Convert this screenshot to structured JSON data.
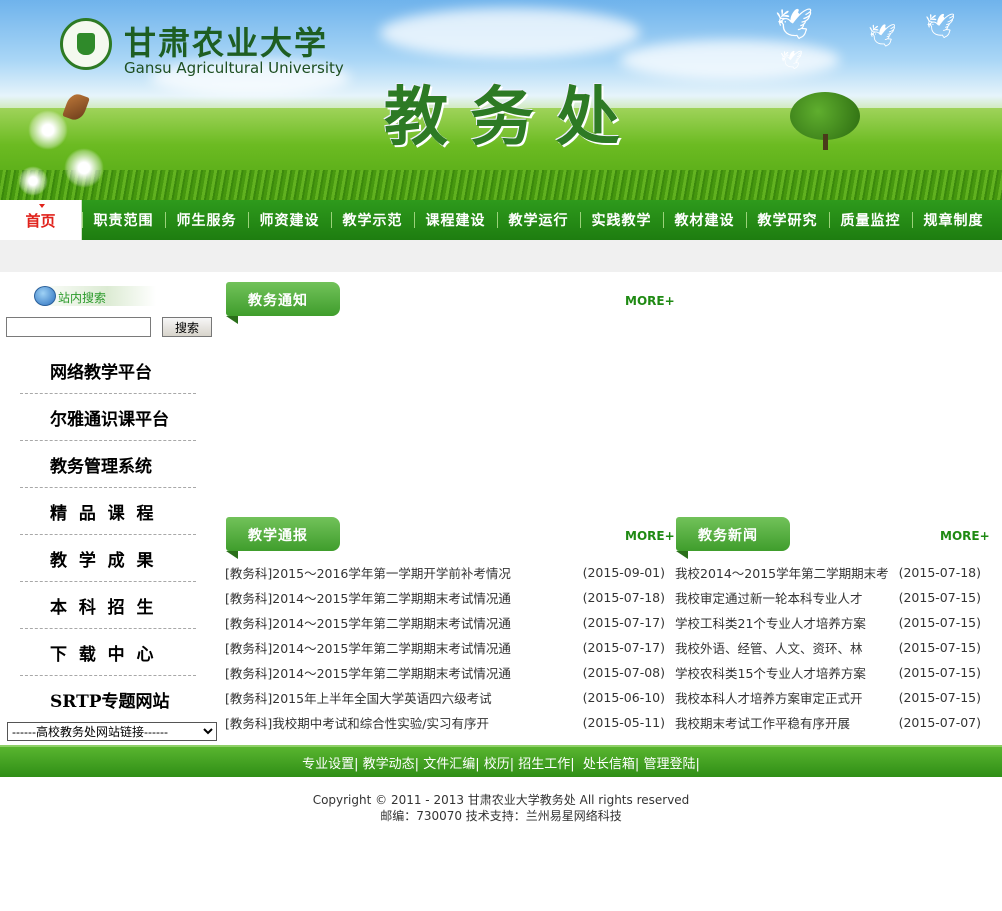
{
  "banner": {
    "university_cn": "甘肃农业大学",
    "university_en": "Gansu Agricultural University",
    "department": "教务处"
  },
  "nav": {
    "home": "首页",
    "items": [
      "职责范围",
      "师生服务",
      "师资建设",
      "教学示范",
      "课程建设",
      "教学运行",
      "实践教学",
      "教材建设",
      "教学研究",
      "质量监控",
      "规章制度"
    ]
  },
  "search": {
    "title": "站内搜索",
    "button": "搜索",
    "value": ""
  },
  "sidebar": {
    "links": [
      "网络教学平台",
      "尔雅通识课平台",
      "教务管理系统",
      "精  品  课  程",
      "教  学  成  果",
      "本  科  招  生",
      "下  载  中  心",
      "SRTP专题网站"
    ],
    "select_value": "------高校教务处网站链接------"
  },
  "sections": {
    "notice": {
      "title": "教务通知",
      "more": "MORE+"
    },
    "report": {
      "title": "教学通报",
      "more": "MORE+",
      "items": [
        {
          "title": "[教务科]2015～2016学年第一学期开学前补考情况",
          "date": "(2015-09-01)"
        },
        {
          "title": "[教务科]2014～2015学年第二学期期末考试情况通",
          "date": "(2015-07-18)"
        },
        {
          "title": "[教务科]2014～2015学年第二学期期末考试情况通",
          "date": "(2015-07-17)"
        },
        {
          "title": "[教务科]2014～2015学年第二学期期末考试情况通",
          "date": "(2015-07-17)"
        },
        {
          "title": "[教务科]2014～2015学年第二学期期末考试情况通",
          "date": "(2015-07-08)"
        },
        {
          "title": "[教务科]2015年上半年全国大学英语四六级考试",
          "date": "(2015-06-10)"
        },
        {
          "title": "[教务科]我校期中考试和综合性实验/实习有序开",
          "date": "(2015-05-11)"
        }
      ]
    },
    "news": {
      "title": "教务新闻",
      "more": "MORE+",
      "items": [
        {
          "title": "我校2014～2015学年第二学期期末考",
          "date": "(2015-07-18)"
        },
        {
          "title": "我校审定通过新一轮本科专业人才",
          "date": "(2015-07-15)"
        },
        {
          "title": "学校工科类21个专业人才培养方案",
          "date": "(2015-07-15)"
        },
        {
          "title": "我校外语、经管、人文、资环、林",
          "date": "(2015-07-15)"
        },
        {
          "title": "学校农科类15个专业人才培养方案",
          "date": "(2015-07-15)"
        },
        {
          "title": "我校本科人才培养方案审定正式开",
          "date": "(2015-07-15)"
        },
        {
          "title": "我校期末考试工作平稳有序开展",
          "date": "(2015-07-07)"
        }
      ]
    }
  },
  "footer": {
    "links": [
      "专业设置|",
      "教学动态|",
      "文件汇编|",
      "校历|",
      "招生工作|",
      "处长信箱|",
      "管理登陆|"
    ],
    "copyright": "Copyright © 2011 - 2013 甘肃农业大学教务处 All rights reserved",
    "contact": "邮编：730070 技术支持：兰州易星网络科技"
  }
}
